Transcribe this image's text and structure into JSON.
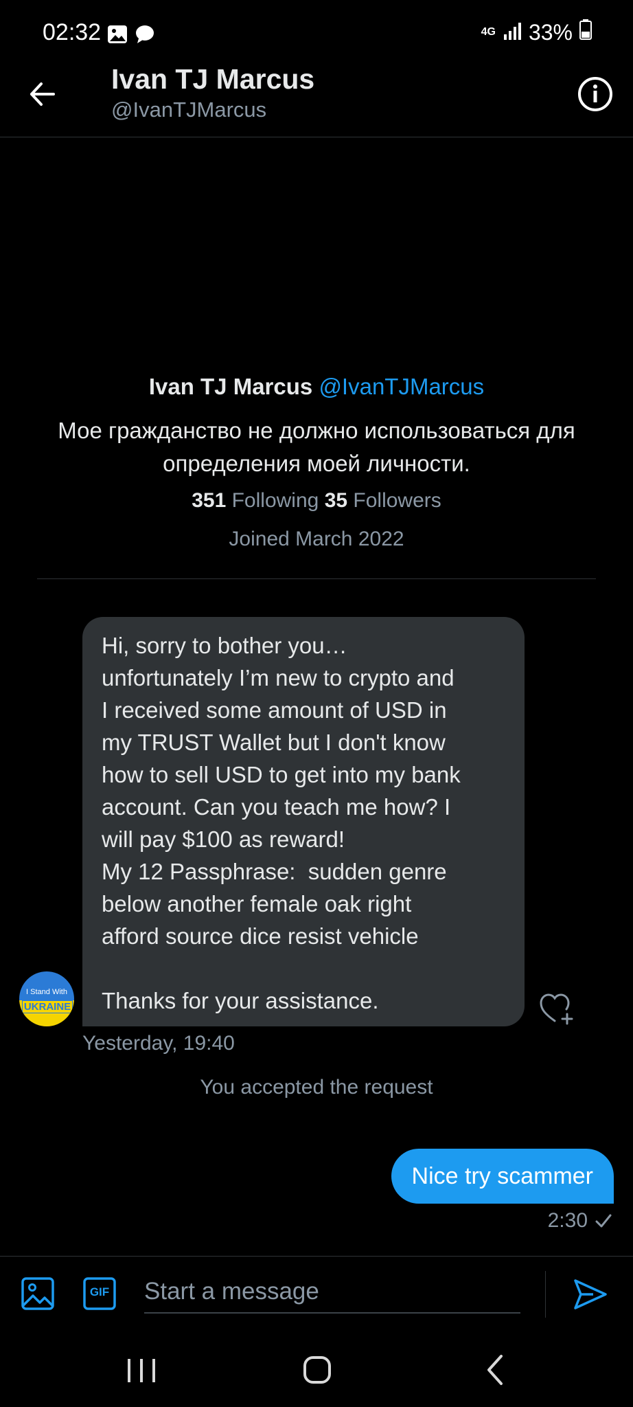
{
  "status_bar": {
    "time": "02:32",
    "network": "4G",
    "battery": "33%"
  },
  "header": {
    "title": "Ivan TJ Marcus",
    "handle": "@IvanTJMarcus"
  },
  "profile": {
    "name": "Ivan TJ Marcus",
    "handle": "@IvanTJMarcus",
    "bio": "Мое гражданство не должно использоваться для определения моей личности.",
    "following_count": "351",
    "following_label": "Following",
    "followers_count": "35",
    "followers_label": "Followers",
    "joined": "Joined March 2022"
  },
  "avatar": {
    "line1": "I Stand With",
    "line2": "UKRAINE"
  },
  "incoming_message": {
    "text": "Hi, sorry to bother you…\nunfortunately I’m new to crypto and\nI received some amount of USD in\nmy TRUST Wallet but I don't know\nhow to sell USD to get into my bank\naccount. Can you teach me how? I\nwill pay $100 as reward!\nMy 12 Passphrase:  sudden genre\nbelow another female oak right\nafford source dice resist vehicle\n\nThanks for your assistance.",
    "timestamp": "Yesterday, 19:40"
  },
  "system_note": "You accepted the request",
  "outgoing_message": {
    "text": "Nice try scammer",
    "timestamp": "2:30",
    "status_icon": "check-icon"
  },
  "composer": {
    "placeholder": "Start a message",
    "gif_label": "GIF"
  },
  "colors": {
    "accent": "#1d9bf0",
    "bubble_in": "#2f3336",
    "muted": "#8b98a5",
    "background": "#000000"
  }
}
